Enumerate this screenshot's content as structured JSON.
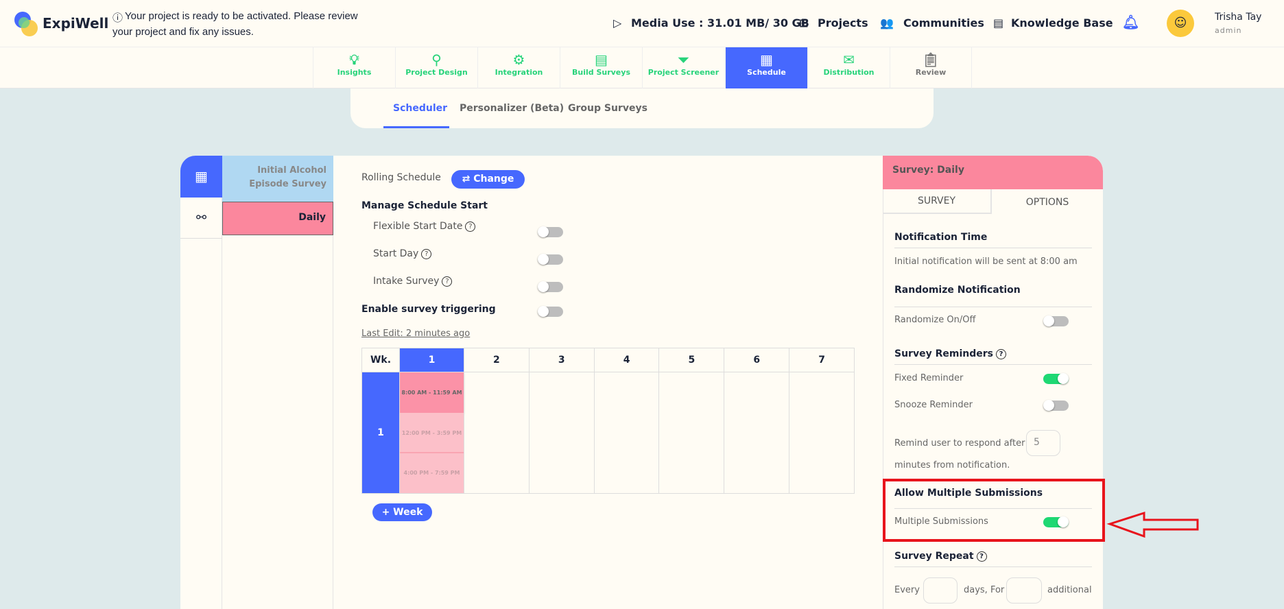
{
  "header": {
    "logo": "ExpiWell",
    "notice_line1": "Your project is ready to be activated. Please review",
    "notice_line2": "your project and fix any issues.",
    "media_use": "Media Use : 31.01 MB/ 30 GB",
    "projects": "Projects",
    "communities": "Communities",
    "knowledge_base": "Knowledge Base",
    "user_name": "Trisha Tay",
    "user_role": "admin"
  },
  "nav": [
    {
      "label": "Insights",
      "icon": "lightbulb-icon"
    },
    {
      "label": "Project Design",
      "icon": "compass-icon"
    },
    {
      "label": "Integration",
      "icon": "gears-icon"
    },
    {
      "label": "Build Surveys",
      "icon": "form-icon"
    },
    {
      "label": "Project Screener",
      "icon": "filter-icon"
    },
    {
      "label": "Schedule",
      "icon": "calendar-icon",
      "active": true
    },
    {
      "label": "Distribution",
      "icon": "mailbox-icon"
    },
    {
      "label": "Review",
      "icon": "clipboard-icon"
    }
  ],
  "subtabs": {
    "scheduler": "Scheduler",
    "personalizer": "Personalizer (Beta)",
    "group": "Group Surveys"
  },
  "surveys": [
    {
      "name": "Initial Alcohol Episode Survey",
      "color": "#b0d8f2"
    },
    {
      "name": "Daily",
      "color": "#fb879d"
    }
  ],
  "schedule": {
    "rolling": "Rolling Schedule",
    "change": "Change",
    "manage_start": "Manage Schedule Start",
    "flexible": "Flexible Start Date",
    "start_day": "Start Day",
    "intake": "Intake Survey",
    "triggering": "Enable survey triggering",
    "last_edit": "Last Edit: 2 minutes ago",
    "add_week": "+ Week",
    "table": {
      "wk": "Wk.",
      "days": [
        "1",
        "2",
        "3",
        "4",
        "5",
        "6",
        "7"
      ],
      "week": "1",
      "slots": [
        "8:00 AM - 11:59 AM",
        "12:00 PM - 3:59 PM",
        "4:00 PM - 7:59 PM"
      ]
    }
  },
  "toggles": {
    "flexible": false,
    "start_day": false,
    "intake": false,
    "triggering": false,
    "randomize": false,
    "fixed_reminder": true,
    "snooze_reminder": false,
    "multiple_submissions": true
  },
  "panel": {
    "title": "Survey: Daily",
    "tab_survey": "SURVEY",
    "tab_options": "OPTIONS",
    "notif_time": "Notification Time",
    "notif_text": "Initial notification will be sent at 8:00 am",
    "randomize_title": "Randomize Notification",
    "randomize_label": "Randomize On/Off",
    "reminders": "Survey Reminders",
    "fixed": "Fixed Reminder",
    "snooze": "Snooze Reminder",
    "remind_a": "Remind user to respond after",
    "remind_value": "5",
    "remind_b": "minutes from notification.",
    "allow_multi": "Allow Multiple Submissions",
    "multi": "Multiple Submissions",
    "repeat": "Survey Repeat",
    "every": "Every",
    "days_for": "days, For",
    "additional": "additional"
  },
  "colors": {
    "accent": "#4668fe",
    "green": "#1ed873",
    "pink": "#fb879d",
    "highlight": "#e8141c"
  }
}
